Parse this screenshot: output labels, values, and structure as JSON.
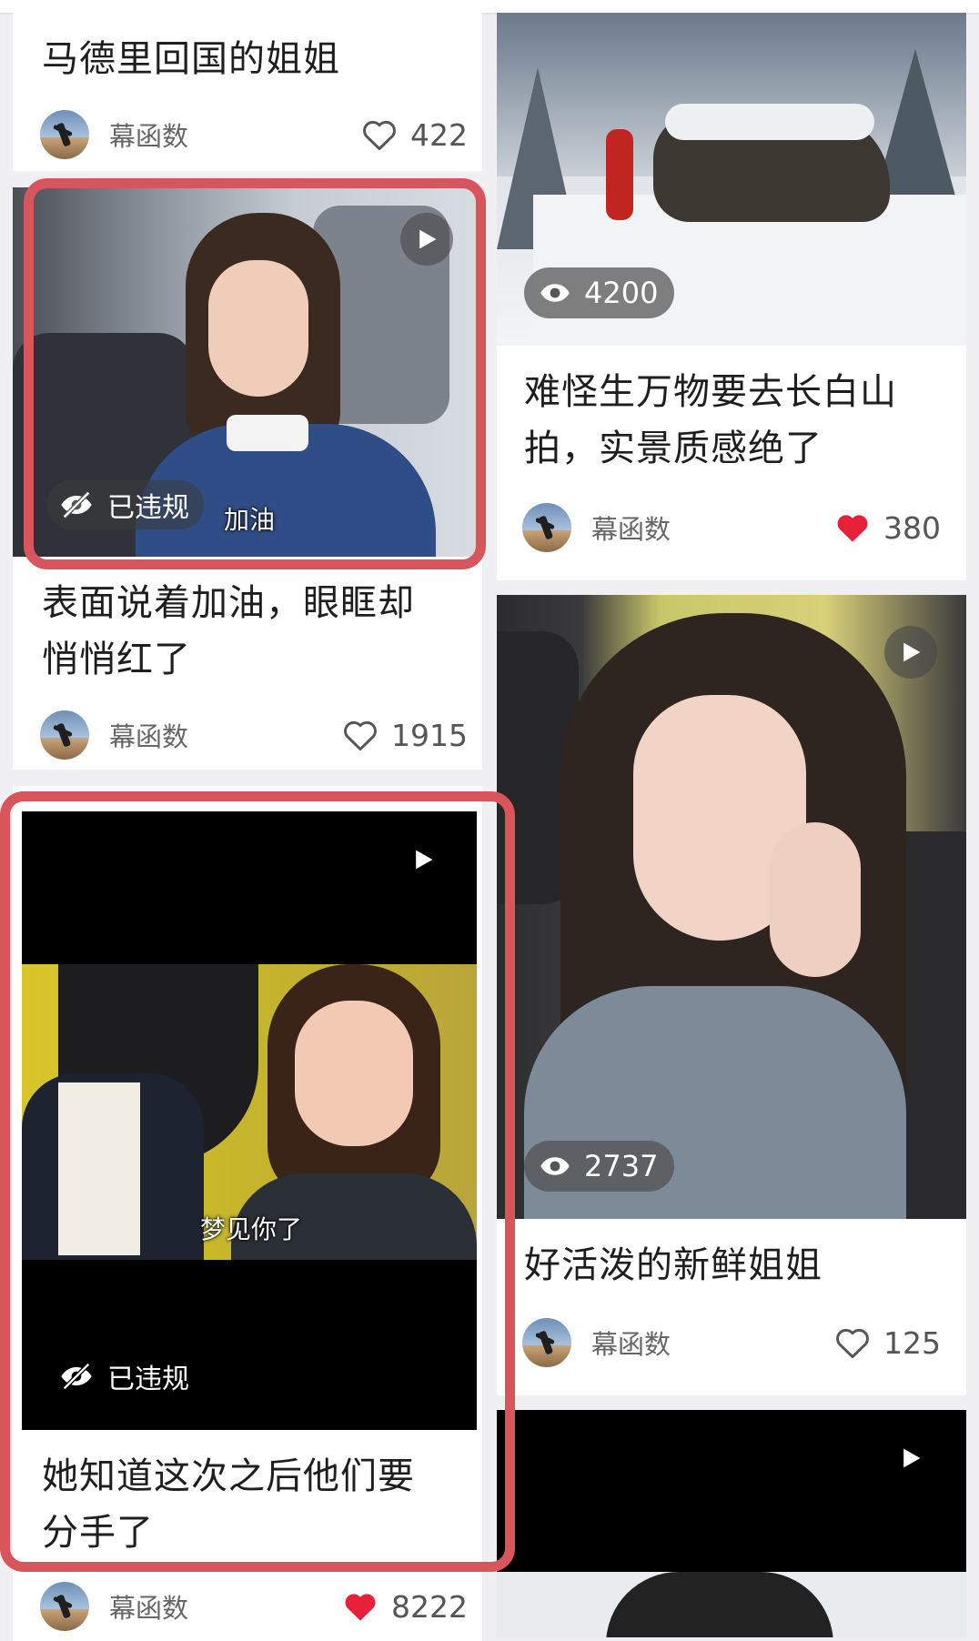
{
  "feed": {
    "left": [
      {
        "title": "马德里回国的姐姐",
        "author": "幕函数",
        "likes": "422",
        "liked": false
      },
      {
        "title": "表面说着加油，眼眶却悄悄红了",
        "title_lines": [
          "表面说着加油，眼眶却",
          "悄悄红了"
        ],
        "video_subtitle": "加油",
        "badge": "已违规",
        "author": "幕函数",
        "likes": "1915",
        "liked": false
      },
      {
        "title": "她知道这次之后他们要分手了",
        "title_lines": [
          "她知道这次之后他们要",
          "分手了"
        ],
        "video_subtitle": "梦见你了",
        "badge": "已违规",
        "author": "幕函数",
        "likes": "8222",
        "liked": true
      }
    ],
    "right": [
      {
        "views": "4200",
        "title": "难怪生万物要去长白山拍，实景质感绝了",
        "title_lines": [
          "难怪生万物要去长白山",
          "拍，实景质感绝了"
        ],
        "author": "幕函数",
        "likes": "380",
        "liked": true
      },
      {
        "views": "2737",
        "title": "好活泼的新鲜姐姐",
        "author": "幕函数",
        "likes": "125",
        "liked": false
      },
      {
        "title": ""
      }
    ]
  },
  "colors": {
    "highlight": "#d9555c",
    "liked_heart": "#e8203a",
    "unliked_heart": "#555555"
  },
  "icons": [
    "heart-outline-icon",
    "heart-filled-icon",
    "eye-icon",
    "play-icon",
    "hidden-eye-icon"
  ]
}
